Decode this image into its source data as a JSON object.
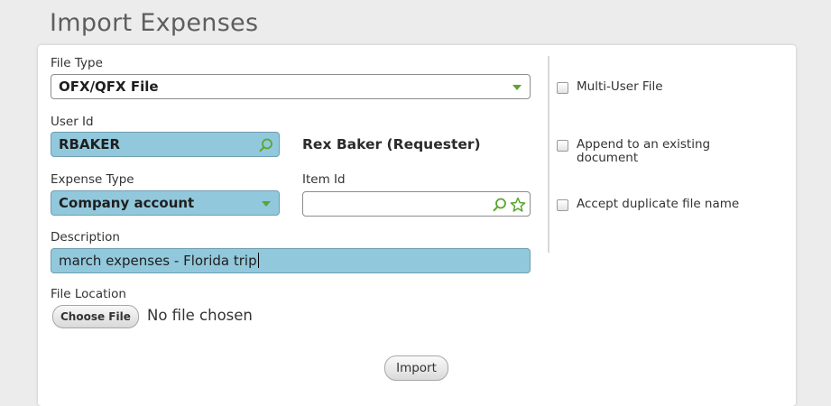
{
  "page": {
    "title": "Import Expenses"
  },
  "form": {
    "file_type": {
      "label": "File Type",
      "value": "OFX/QFX File"
    },
    "user_id": {
      "label": "User Id",
      "value": "RBAKER",
      "resolved_name": "Rex Baker (Requester)"
    },
    "expense_type": {
      "label": "Expense Type",
      "value": "Company account"
    },
    "item_id": {
      "label": "Item Id",
      "value": ""
    },
    "description": {
      "label": "Description",
      "value": "march expenses - Florida trip"
    },
    "file_location": {
      "label": "File Location",
      "choose_label": "Choose File",
      "status": "No file chosen"
    },
    "import_label": "Import"
  },
  "options": [
    {
      "label": "Multi-User File",
      "checked": false
    },
    {
      "label": "Append to an existing document",
      "checked": false
    },
    {
      "label": "Accept duplicate file name",
      "checked": false
    }
  ],
  "colors": {
    "highlight": "#92c8dc",
    "accent_green": "#5aa62e",
    "panel": "#ffffff",
    "background": "#ececec"
  },
  "icons": [
    "search-icon",
    "star-icon",
    "chevron-down-icon"
  ]
}
